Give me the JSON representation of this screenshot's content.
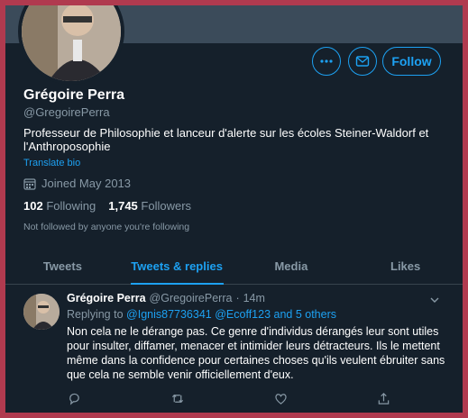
{
  "profile": {
    "name": "Grégoire Perra",
    "handle": "@GregoirePerra",
    "bio": "Professeur de Philosophie et lanceur d'alerte sur les écoles Steiner-Waldorf et l'Anthroposophie",
    "translate_label": "Translate bio",
    "joined": "Joined May 2013",
    "following_count": "102",
    "following_label": "Following",
    "followers_count": "1,745",
    "followers_label": "Followers",
    "not_followed": "Not followed by anyone you're following"
  },
  "actions": {
    "more_icon": "more-icon",
    "message_icon": "message-icon",
    "follow_label": "Follow"
  },
  "tabs": [
    {
      "label": "Tweets"
    },
    {
      "label": "Tweets & replies",
      "active": true
    },
    {
      "label": "Media"
    },
    {
      "label": "Likes"
    }
  ],
  "tweet": {
    "name": "Grégoire Perra",
    "handle": "@GregoirePerra",
    "separator": "·",
    "time": "14m",
    "replying_prefix": "Replying to",
    "replying_mentions": "@Ignis87736341 @Ecoff123 and 5 others",
    "text": "Non cela ne le dérange pas. Ce genre d'individus dérangés leur sont utiles pour insulter, diffamer, menacer et intimider leurs détracteurs. Ils le mettent même dans la confidence pour certaines choses qu'ils veulent ébruiter sans que cela ne semble venir officiellement d'eux."
  },
  "colors": {
    "background": "#15202b",
    "accent": "#1da1f2",
    "muted": "#8899a6",
    "frame": "#b03a4f"
  }
}
